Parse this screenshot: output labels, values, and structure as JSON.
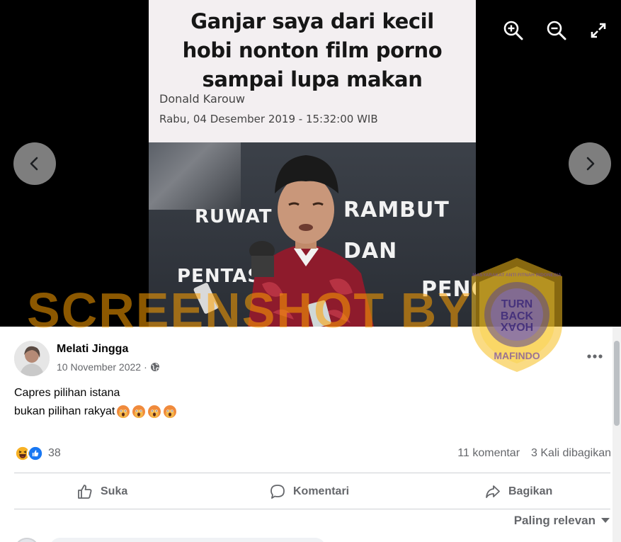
{
  "viewer": {
    "article": {
      "headline_lines": [
        "Ganjar saya dari kecil",
        "hobi nonton film porno",
        "sampai lupa makan"
      ],
      "author": "Donald Karouw",
      "date": "Rabu, 04 Desember 2019 - 15:32:00 WIB"
    },
    "photo_banner": {
      "line1_left": "RUWAT CU",
      "line1_right": "RAMBUT",
      "line2": "DAN",
      "line3_left": "PENTAS K",
      "line3_right": "PENG"
    },
    "controls": {
      "zoom_in_icon": "zoom-in-icon",
      "zoom_out_icon": "zoom-out-icon",
      "fullscreen_icon": "expand-icon",
      "prev_icon": "chevron-left-icon",
      "next_icon": "chevron-right-icon"
    }
  },
  "watermark": {
    "text": "SCREENSHOT BY",
    "badge_top": "MASYARAKAT ANTI FITNAH INDONESIA",
    "badge_center": [
      "TURN",
      "BACK",
      "HOAX"
    ],
    "badge_bottom": "MAFINDO",
    "color": "#ffa000"
  },
  "post": {
    "author": "Melati Jingga",
    "date": "10 November 2022",
    "separator": "·",
    "privacy_icon": "globe-icon",
    "text_line1": "Capres pilihan istana",
    "text_line2": "bukan pilihan rakyat",
    "text_emojis": [
      "angry-face-emoji",
      "angry-face-emoji",
      "angry-face-emoji",
      "angry-face-emoji"
    ],
    "reaction_icons": [
      "haha-icon",
      "like-icon"
    ],
    "reaction_count": "38",
    "comments": "11 komentar",
    "shares": "3 Kali dibagikan",
    "actions": {
      "like": "Suka",
      "comment": "Komentari",
      "share": "Bagikan"
    },
    "sort_label": "Paling relevan",
    "colors": {
      "secondary_text": "#65676b",
      "like_blue": "#1877f2",
      "haha_yellow": "#f7b125"
    }
  }
}
